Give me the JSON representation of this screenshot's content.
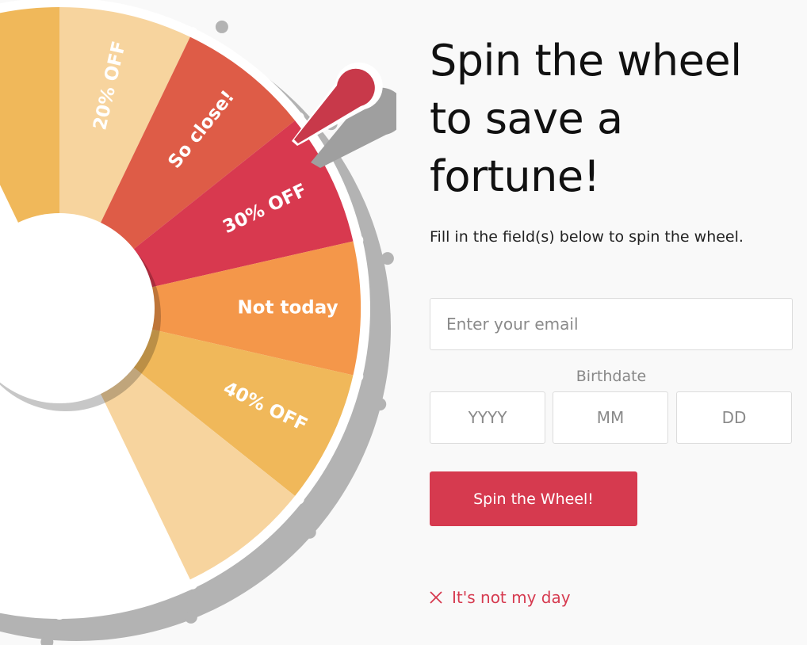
{
  "wheel": {
    "slices": [
      {
        "label": "20% OFF",
        "color": "#f7d49e"
      },
      {
        "label": "So close!",
        "color": "#de5c47"
      },
      {
        "label": "30% OFF",
        "color": "#d8394f"
      },
      {
        "label": "Not today",
        "color": "#f4974a"
      },
      {
        "label": "40% OFF",
        "color": "#f0b85a"
      }
    ],
    "rim_color": "#ffffff",
    "shadow_color": "#b3b3b3",
    "pointer_color": "#c8394a"
  },
  "headline": "Spin the wheel to save a fortune!",
  "subtext": "Fill in the field(s) below to spin the wheel.",
  "form": {
    "email_placeholder": "Enter your email",
    "birthdate_label": "Birthdate",
    "year_placeholder": "YYYY",
    "month_placeholder": "MM",
    "day_placeholder": "DD",
    "submit_label": "Spin the Wheel!"
  },
  "decline_label": "It's not my day",
  "colors": {
    "accent": "#d63a4f",
    "background": "#f9f9f9"
  }
}
